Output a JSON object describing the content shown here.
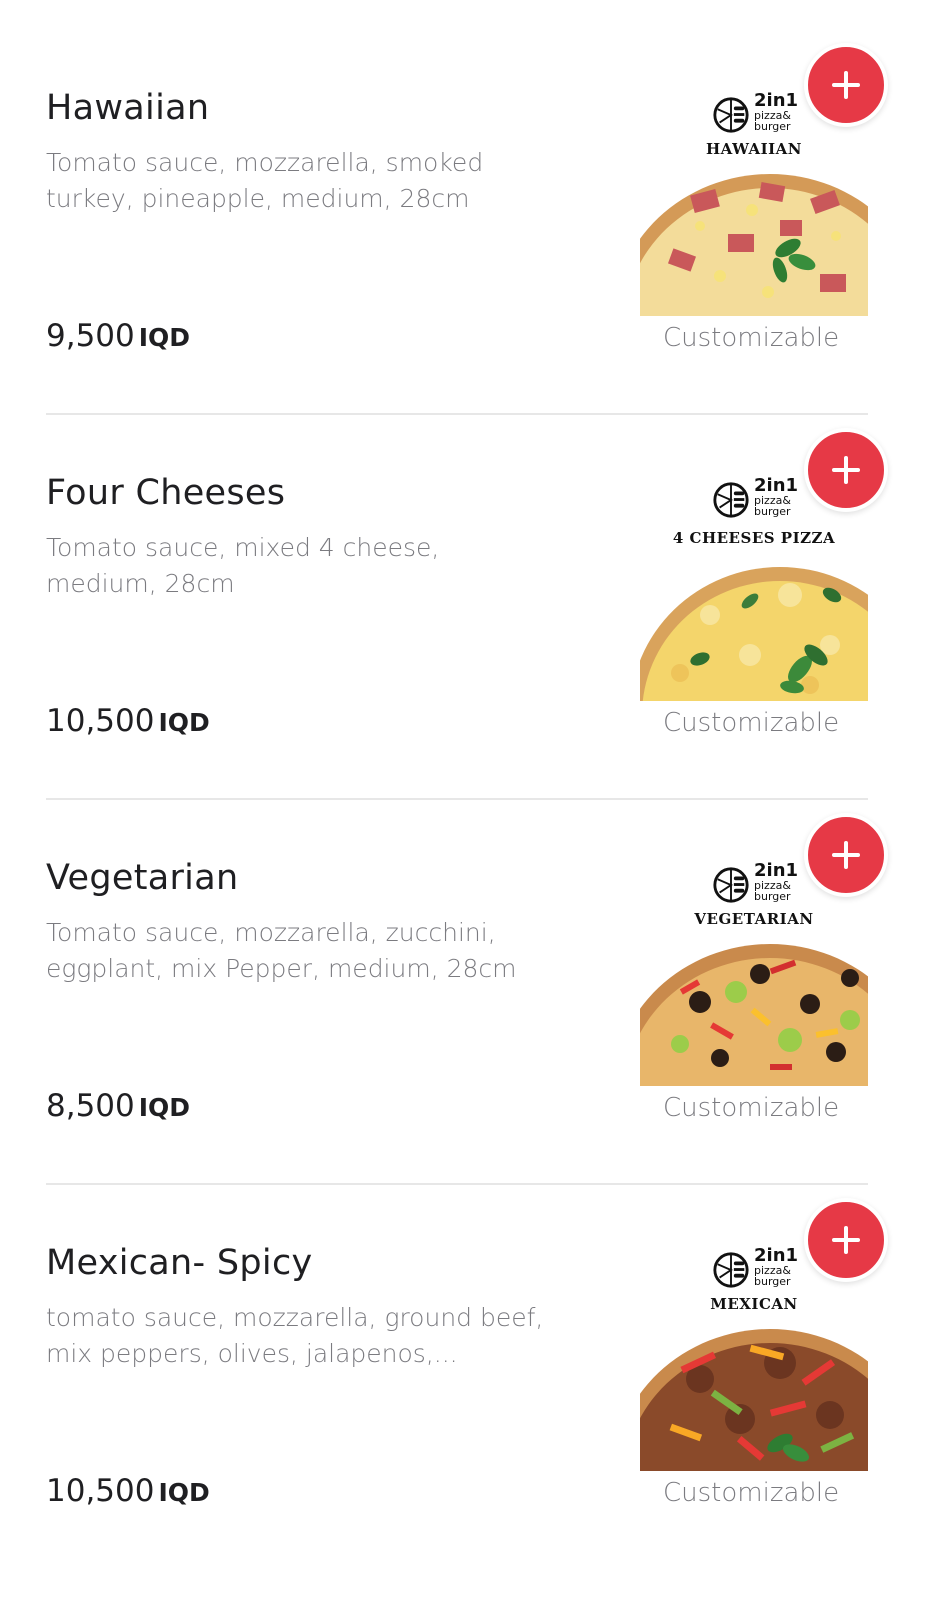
{
  "colors": {
    "accent": "#e63946",
    "text_primary": "#1f1f22",
    "text_secondary": "#7b7b80",
    "divider": "#e7e7e7"
  },
  "icons": {
    "add": "plus-icon",
    "brand": "pizza-burger-logo-icon"
  },
  "brand": {
    "main": "2in1",
    "sub_line1": "pizza&",
    "sub_line2": "burger"
  },
  "items": [
    {
      "name": "Hawaiian",
      "description": "Tomato sauce, mozzarella, smoked turkey, pineapple, medium, 28cm",
      "price": "9,500",
      "currency": "IQD",
      "badge": "Customizable",
      "image_label": "HAWAIIAN"
    },
    {
      "name": "Four Cheeses",
      "description": "Tomato sauce, mixed 4 cheese, medium, 28cm",
      "price": "10,500",
      "currency": "IQD",
      "badge": "Customizable",
      "image_label": "4 CHEESES PIZZA"
    },
    {
      "name": "Vegetarian",
      "description": "Tomato sauce, mozzarella, zucchini, eggplant, mix Pepper, medium, 28cm",
      "price": "8,500",
      "currency": "IQD",
      "badge": "Customizable",
      "image_label": "VEGETARIAN"
    },
    {
      "name": "Mexican- Spicy",
      "description": "tomato sauce, mozzarella, ground beef, mix peppers, olives, jalapenos,...",
      "price": "10,500",
      "currency": "IQD",
      "badge": "Customizable",
      "image_label": "MEXICAN"
    }
  ]
}
